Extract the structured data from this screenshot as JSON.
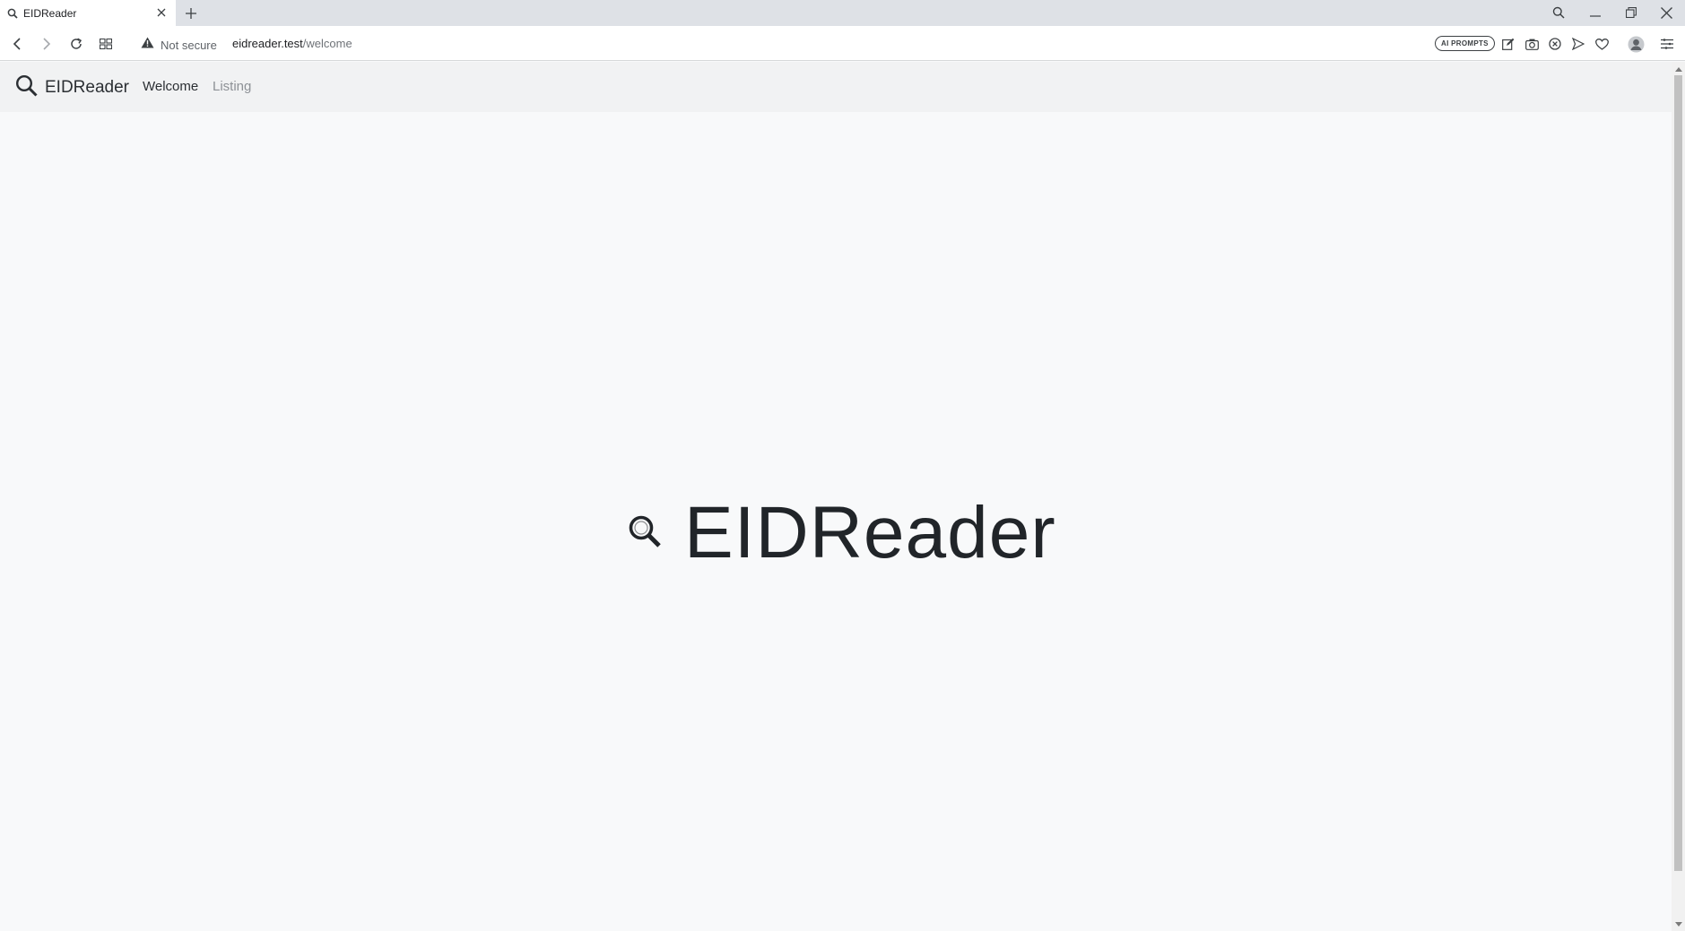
{
  "browser": {
    "tab": {
      "title": "EIDReader"
    },
    "address_bar": {
      "security_label": "Not secure",
      "url_host": "eidreader.test",
      "url_path": "/welcome"
    },
    "extensions": {
      "ai_prompts_label": "AI PROMPTS"
    }
  },
  "navbar": {
    "brand": "EIDReader",
    "links": [
      {
        "label": "Welcome",
        "active": true
      },
      {
        "label": "Listing",
        "active": false
      }
    ]
  },
  "hero": {
    "title": "EIDReader"
  },
  "colors": {
    "page_background": "#f8f9fa",
    "navbar_background": "#f1f2f3",
    "text_primary": "#212529",
    "nav_inactive": "#8d9196"
  }
}
